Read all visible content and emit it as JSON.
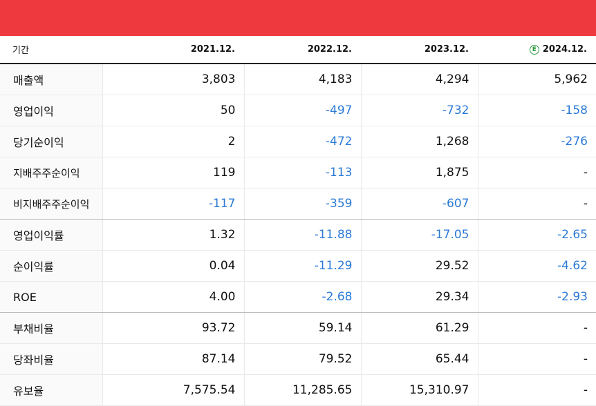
{
  "header": {
    "label": "기간",
    "periods": [
      "2021.12.",
      "2022.12.",
      "2023.12.",
      "2024.12."
    ],
    "estimate_marker": "Ⓔ",
    "estimate_color": "#2a9a3b"
  },
  "colors": {
    "brand_bar": "#ee3a3e",
    "negative": "#2b7ad6"
  },
  "rows": [
    {
      "label": "매출액",
      "values": [
        "3,803",
        "4,183",
        "4,294",
        "5,962"
      ]
    },
    {
      "label": "영업이익",
      "values": [
        "50",
        "-497",
        "-732",
        "-158"
      ]
    },
    {
      "label": "당기순이익",
      "values": [
        "2",
        "-472",
        "1,268",
        "-276"
      ]
    },
    {
      "label": "지배주주순이익",
      "values": [
        "119",
        "-113",
        "1,875",
        "-"
      ]
    },
    {
      "label": "비지배주주순이익",
      "values": [
        "-117",
        "-359",
        "-607",
        "-"
      ]
    },
    {
      "label": "영업이익률",
      "values": [
        "1.32",
        "-11.88",
        "-17.05",
        "-2.65"
      ]
    },
    {
      "label": "순이익률",
      "values": [
        "0.04",
        "-11.29",
        "29.52",
        "-4.62"
      ]
    },
    {
      "label": "ROE",
      "values": [
        "4.00",
        "-2.68",
        "29.34",
        "-2.93"
      ]
    },
    {
      "label": "부채비율",
      "values": [
        "93.72",
        "59.14",
        "61.29",
        "-"
      ]
    },
    {
      "label": "당좌비율",
      "values": [
        "87.14",
        "79.52",
        "65.44",
        "-"
      ]
    },
    {
      "label": "유보율",
      "values": [
        "7,575.54",
        "11,285.65",
        "15,310.97",
        "-"
      ]
    }
  ]
}
